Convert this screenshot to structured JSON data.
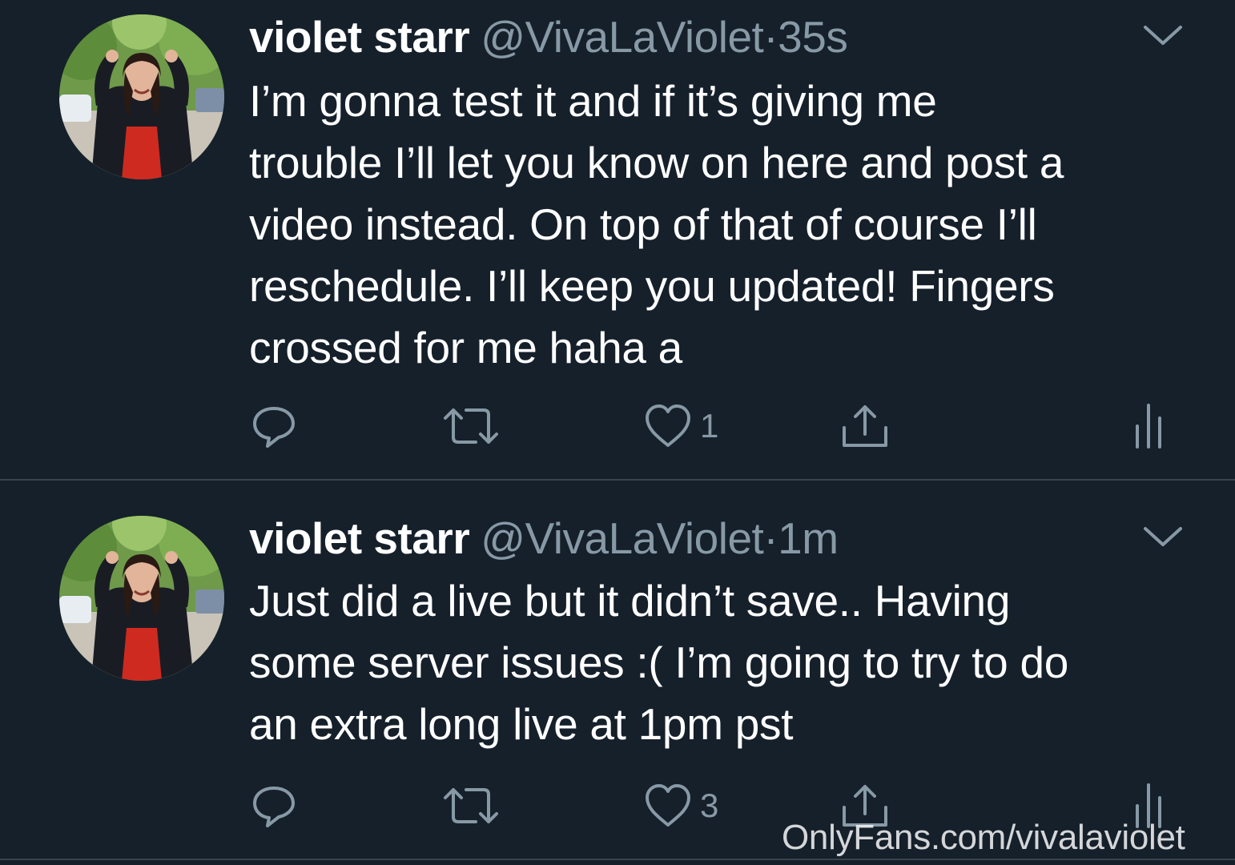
{
  "colors": {
    "background": "#15202b",
    "divider": "#38444d",
    "primary_text": "#ffffff",
    "secondary_text": "#8899a6"
  },
  "tweets": [
    {
      "display_name": "violet starr",
      "handle": "@VivaLaViolet",
      "separator": "·",
      "time": "35s",
      "text_lines": [
        "I’m gonna test it and if it’s giving me",
        "trouble I’ll let you know on here and post a",
        "video instead. On top of that of course I’ll",
        "reschedule. I’ll keep you updated! Fingers",
        "crossed for me haha a"
      ],
      "actions": {
        "reply_icon": "reply-icon",
        "retweet_icon": "retweet-icon",
        "like_icon": "heart-icon",
        "like_count": "1",
        "share_icon": "share-icon",
        "analytics_icon": "analytics-icon"
      },
      "menu_icon": "chevron-down-icon"
    },
    {
      "display_name": "violet starr",
      "handle": "@VivaLaViolet",
      "separator": "·",
      "time": "1m",
      "text_lines": [
        "Just did a live but it didn’t save.. Having",
        "some server issues :( I’m going to try to do",
        "an extra long live at 1pm pst"
      ],
      "actions": {
        "reply_icon": "reply-icon",
        "retweet_icon": "retweet-icon",
        "like_icon": "heart-icon",
        "like_count": "3",
        "share_icon": "share-icon",
        "analytics_icon": "analytics-icon"
      },
      "menu_icon": "chevron-down-icon"
    }
  ],
  "watermark": "OnlyFans.com/vivalaviolet"
}
